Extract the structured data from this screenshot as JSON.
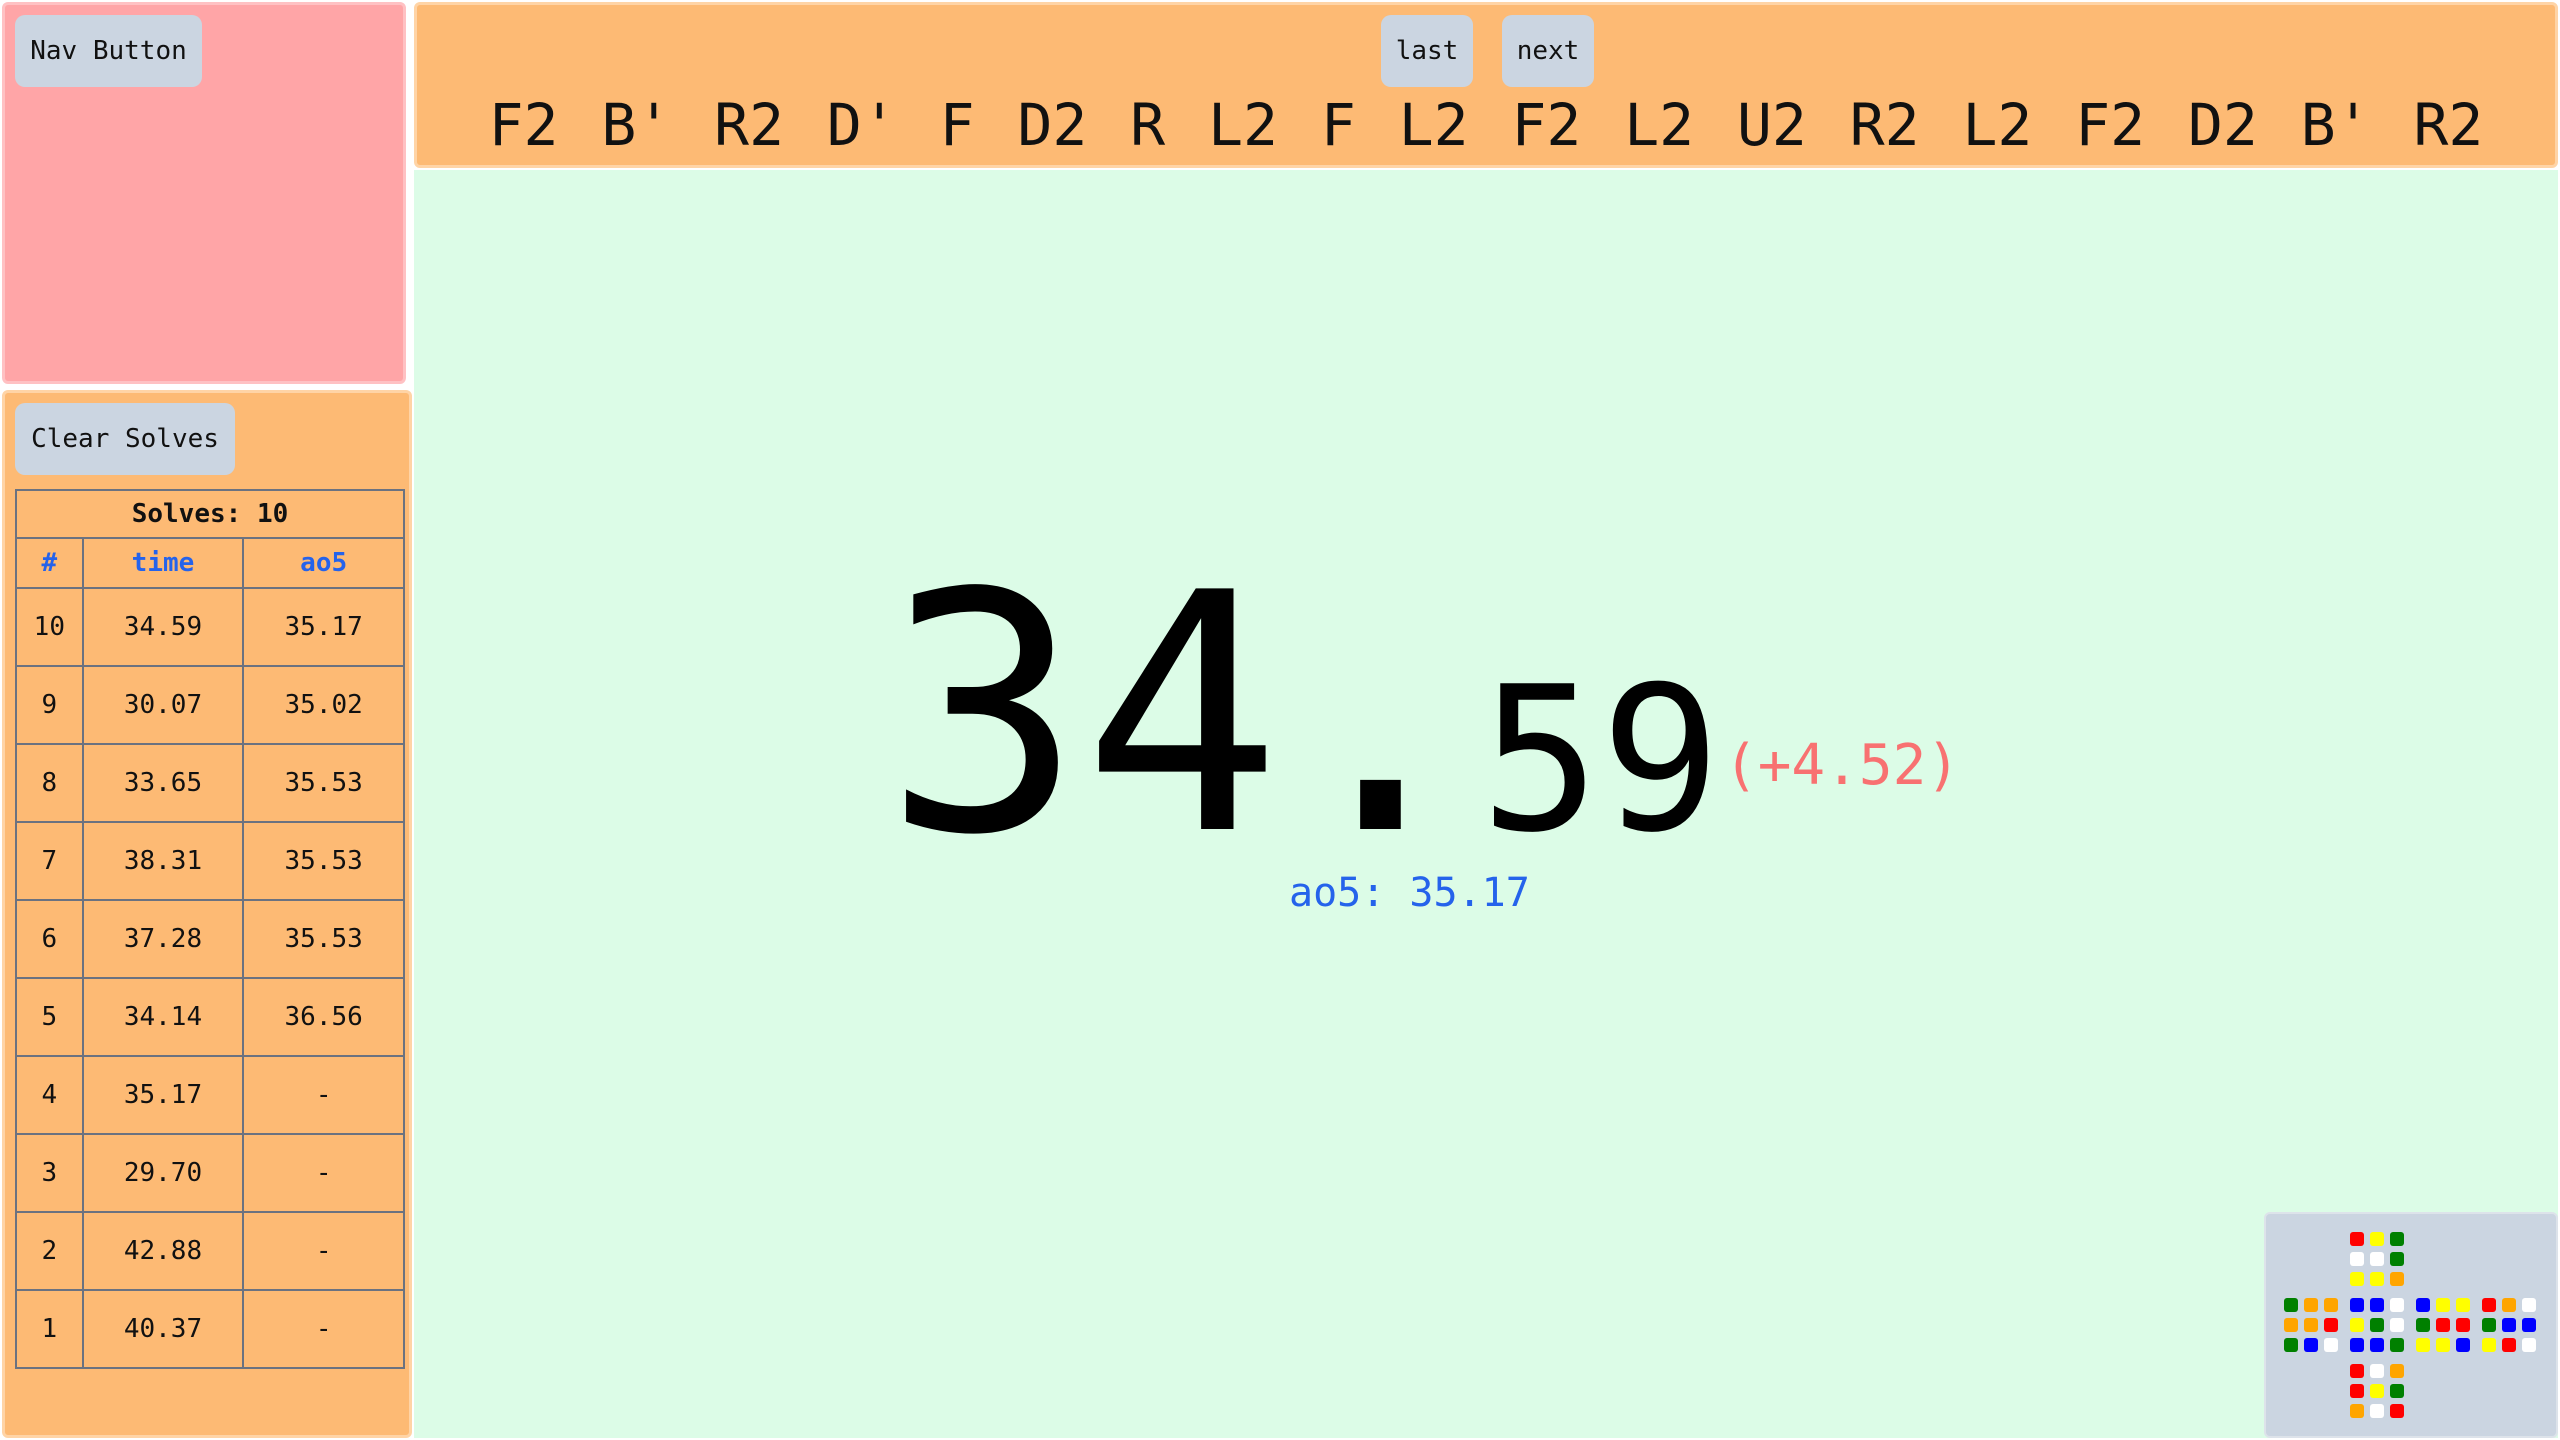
{
  "nav": {
    "button_label": "Nav Button"
  },
  "solves_panel": {
    "clear_label": "Clear Solves",
    "header": "Solves: 10",
    "columns": [
      "#",
      "time",
      "ao5"
    ],
    "rows": [
      [
        "10",
        "34.59",
        "35.17"
      ],
      [
        "9",
        "30.07",
        "35.02"
      ],
      [
        "8",
        "33.65",
        "35.53"
      ],
      [
        "7",
        "38.31",
        "35.53"
      ],
      [
        "6",
        "37.28",
        "35.53"
      ],
      [
        "5",
        "34.14",
        "36.56"
      ],
      [
        "4",
        "35.17",
        "-"
      ],
      [
        "3",
        "29.70",
        "-"
      ],
      [
        "2",
        "42.88",
        "-"
      ],
      [
        "1",
        "40.37",
        "-"
      ]
    ]
  },
  "scramble": {
    "last_label": "last",
    "next_label": "next",
    "moves": "F2 B' R2 D' F D2 R L2 F L2 F2 L2 U2 R2 L2 F2 D2 B' R2"
  },
  "timer": {
    "seconds": "34",
    "dot": ".",
    "fraction": "59",
    "delta": "(+4.52)",
    "ao5_text": "ao5: 35.17"
  },
  "cube_preview": {
    "colors": {
      "w": "#ffffff",
      "y": "#ffff00",
      "r": "#ff0000",
      "o": "#ffa500",
      "g": "#008000",
      "b": "#0000ff"
    },
    "faces": {
      "U": [
        "r",
        "y",
        "g",
        "w",
        "w",
        "g",
        "y",
        "y",
        "o"
      ],
      "L": [
        "g",
        "o",
        "o",
        "o",
        "o",
        "r",
        "g",
        "b",
        "w"
      ],
      "F": [
        "b",
        "b",
        "w",
        "y",
        "g",
        "w",
        "b",
        "b",
        "g"
      ],
      "R": [
        "b",
        "y",
        "y",
        "g",
        "r",
        "r",
        "y",
        "y",
        "b"
      ],
      "B": [
        "r",
        "o",
        "w",
        "g",
        "b",
        "b",
        "y",
        "r",
        "w"
      ],
      "D": [
        "r",
        "w",
        "o",
        "r",
        "y",
        "g",
        "o",
        "w",
        "r"
      ]
    }
  }
}
